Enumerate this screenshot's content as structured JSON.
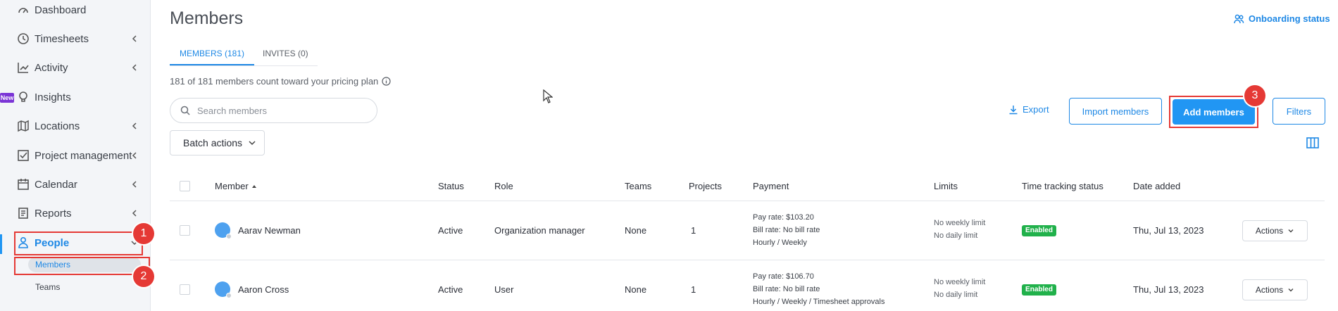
{
  "sidebar": {
    "items": [
      {
        "label": "Dashboard",
        "icon": "dashboard-icon"
      },
      {
        "label": "Timesheets",
        "icon": "clock-icon"
      },
      {
        "label": "Activity",
        "icon": "chart-line-icon"
      },
      {
        "label": "Insights",
        "icon": "lightbulb-icon",
        "badge": "New"
      },
      {
        "label": "Locations",
        "icon": "map-icon"
      },
      {
        "label": "Project management",
        "icon": "checkbox-icon"
      },
      {
        "label": "Calendar",
        "icon": "calendar-icon"
      },
      {
        "label": "Reports",
        "icon": "report-icon"
      },
      {
        "label": "People",
        "icon": "person-icon"
      }
    ],
    "sub_items": [
      {
        "label": "Members"
      },
      {
        "label": "Teams"
      }
    ]
  },
  "annotations": [
    "1",
    "2",
    "3"
  ],
  "header": {
    "title": "Members",
    "onboarding": "Onboarding status"
  },
  "tabs": [
    {
      "label": "MEMBERS (181)"
    },
    {
      "label": "INVITES (0)"
    }
  ],
  "pricing_note": "181 of 181 members count toward your pricing plan",
  "search": {
    "placeholder": "Search members"
  },
  "toolbar": {
    "batch_actions": "Batch actions",
    "export": "Export",
    "import": "Import members",
    "add": "Add members",
    "filters": "Filters"
  },
  "table": {
    "columns": [
      "Member",
      "Status",
      "Role",
      "Teams",
      "Projects",
      "Payment",
      "Limits",
      "Time tracking status",
      "Date added"
    ],
    "rows": [
      {
        "name": "Aarav Newman",
        "status": "Active",
        "role": "Organization manager",
        "teams": "None",
        "projects": "1",
        "pay_rate": "Pay rate: $103.20",
        "bill_rate": "Bill rate: No bill rate",
        "schedule": "Hourly / Weekly",
        "limit_weekly": "No weekly limit",
        "limit_daily": "No daily limit",
        "tracking": "Enabled",
        "date": "Thu, Jul 13, 2023",
        "actions": "Actions"
      },
      {
        "name": "Aaron Cross",
        "status": "Active",
        "role": "User",
        "teams": "None",
        "projects": "1",
        "pay_rate": "Pay rate: $106.70",
        "bill_rate": "Bill rate: No bill rate",
        "schedule": "Hourly / Weekly / Timesheet approvals",
        "limit_weekly": "No weekly limit",
        "limit_daily": "No daily limit",
        "tracking": "Enabled",
        "date": "Thu, Jul 13, 2023",
        "actions": "Actions"
      }
    ]
  },
  "colors": {
    "accent": "#1e88e5",
    "primary_button": "#2196f3",
    "highlight": "#e53935",
    "enabled_badge": "#21b14b",
    "new_badge": "#7b35d6"
  }
}
